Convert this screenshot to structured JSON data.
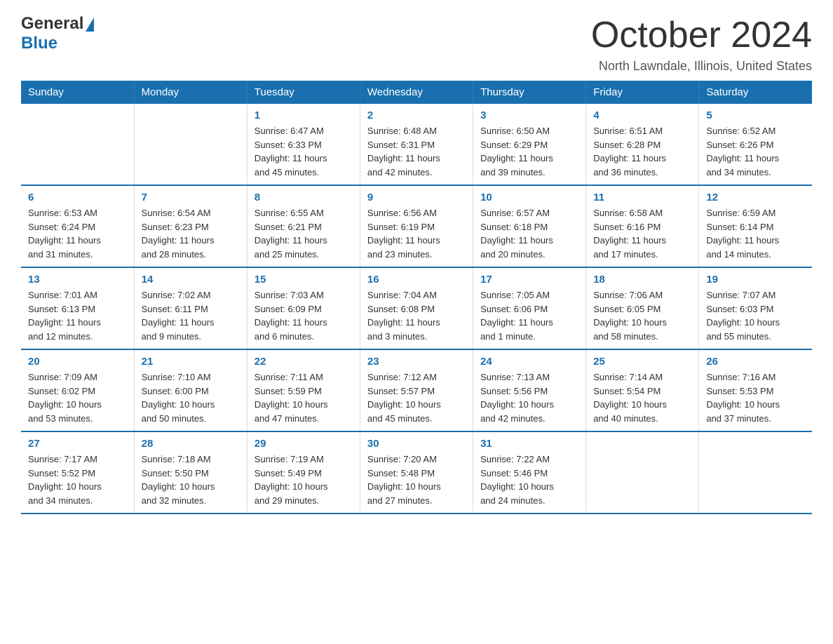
{
  "header": {
    "logo_general": "General",
    "logo_blue": "Blue",
    "month_title": "October 2024",
    "location": "North Lawndale, Illinois, United States"
  },
  "days_of_week": [
    "Sunday",
    "Monday",
    "Tuesday",
    "Wednesday",
    "Thursday",
    "Friday",
    "Saturday"
  ],
  "weeks": [
    [
      {
        "day": "",
        "info": ""
      },
      {
        "day": "",
        "info": ""
      },
      {
        "day": "1",
        "info": "Sunrise: 6:47 AM\nSunset: 6:33 PM\nDaylight: 11 hours\nand 45 minutes."
      },
      {
        "day": "2",
        "info": "Sunrise: 6:48 AM\nSunset: 6:31 PM\nDaylight: 11 hours\nand 42 minutes."
      },
      {
        "day": "3",
        "info": "Sunrise: 6:50 AM\nSunset: 6:29 PM\nDaylight: 11 hours\nand 39 minutes."
      },
      {
        "day": "4",
        "info": "Sunrise: 6:51 AM\nSunset: 6:28 PM\nDaylight: 11 hours\nand 36 minutes."
      },
      {
        "day": "5",
        "info": "Sunrise: 6:52 AM\nSunset: 6:26 PM\nDaylight: 11 hours\nand 34 minutes."
      }
    ],
    [
      {
        "day": "6",
        "info": "Sunrise: 6:53 AM\nSunset: 6:24 PM\nDaylight: 11 hours\nand 31 minutes."
      },
      {
        "day": "7",
        "info": "Sunrise: 6:54 AM\nSunset: 6:23 PM\nDaylight: 11 hours\nand 28 minutes."
      },
      {
        "day": "8",
        "info": "Sunrise: 6:55 AM\nSunset: 6:21 PM\nDaylight: 11 hours\nand 25 minutes."
      },
      {
        "day": "9",
        "info": "Sunrise: 6:56 AM\nSunset: 6:19 PM\nDaylight: 11 hours\nand 23 minutes."
      },
      {
        "day": "10",
        "info": "Sunrise: 6:57 AM\nSunset: 6:18 PM\nDaylight: 11 hours\nand 20 minutes."
      },
      {
        "day": "11",
        "info": "Sunrise: 6:58 AM\nSunset: 6:16 PM\nDaylight: 11 hours\nand 17 minutes."
      },
      {
        "day": "12",
        "info": "Sunrise: 6:59 AM\nSunset: 6:14 PM\nDaylight: 11 hours\nand 14 minutes."
      }
    ],
    [
      {
        "day": "13",
        "info": "Sunrise: 7:01 AM\nSunset: 6:13 PM\nDaylight: 11 hours\nand 12 minutes."
      },
      {
        "day": "14",
        "info": "Sunrise: 7:02 AM\nSunset: 6:11 PM\nDaylight: 11 hours\nand 9 minutes."
      },
      {
        "day": "15",
        "info": "Sunrise: 7:03 AM\nSunset: 6:09 PM\nDaylight: 11 hours\nand 6 minutes."
      },
      {
        "day": "16",
        "info": "Sunrise: 7:04 AM\nSunset: 6:08 PM\nDaylight: 11 hours\nand 3 minutes."
      },
      {
        "day": "17",
        "info": "Sunrise: 7:05 AM\nSunset: 6:06 PM\nDaylight: 11 hours\nand 1 minute."
      },
      {
        "day": "18",
        "info": "Sunrise: 7:06 AM\nSunset: 6:05 PM\nDaylight: 10 hours\nand 58 minutes."
      },
      {
        "day": "19",
        "info": "Sunrise: 7:07 AM\nSunset: 6:03 PM\nDaylight: 10 hours\nand 55 minutes."
      }
    ],
    [
      {
        "day": "20",
        "info": "Sunrise: 7:09 AM\nSunset: 6:02 PM\nDaylight: 10 hours\nand 53 minutes."
      },
      {
        "day": "21",
        "info": "Sunrise: 7:10 AM\nSunset: 6:00 PM\nDaylight: 10 hours\nand 50 minutes."
      },
      {
        "day": "22",
        "info": "Sunrise: 7:11 AM\nSunset: 5:59 PM\nDaylight: 10 hours\nand 47 minutes."
      },
      {
        "day": "23",
        "info": "Sunrise: 7:12 AM\nSunset: 5:57 PM\nDaylight: 10 hours\nand 45 minutes."
      },
      {
        "day": "24",
        "info": "Sunrise: 7:13 AM\nSunset: 5:56 PM\nDaylight: 10 hours\nand 42 minutes."
      },
      {
        "day": "25",
        "info": "Sunrise: 7:14 AM\nSunset: 5:54 PM\nDaylight: 10 hours\nand 40 minutes."
      },
      {
        "day": "26",
        "info": "Sunrise: 7:16 AM\nSunset: 5:53 PM\nDaylight: 10 hours\nand 37 minutes."
      }
    ],
    [
      {
        "day": "27",
        "info": "Sunrise: 7:17 AM\nSunset: 5:52 PM\nDaylight: 10 hours\nand 34 minutes."
      },
      {
        "day": "28",
        "info": "Sunrise: 7:18 AM\nSunset: 5:50 PM\nDaylight: 10 hours\nand 32 minutes."
      },
      {
        "day": "29",
        "info": "Sunrise: 7:19 AM\nSunset: 5:49 PM\nDaylight: 10 hours\nand 29 minutes."
      },
      {
        "day": "30",
        "info": "Sunrise: 7:20 AM\nSunset: 5:48 PM\nDaylight: 10 hours\nand 27 minutes."
      },
      {
        "day": "31",
        "info": "Sunrise: 7:22 AM\nSunset: 5:46 PM\nDaylight: 10 hours\nand 24 minutes."
      },
      {
        "day": "",
        "info": ""
      },
      {
        "day": "",
        "info": ""
      }
    ]
  ]
}
